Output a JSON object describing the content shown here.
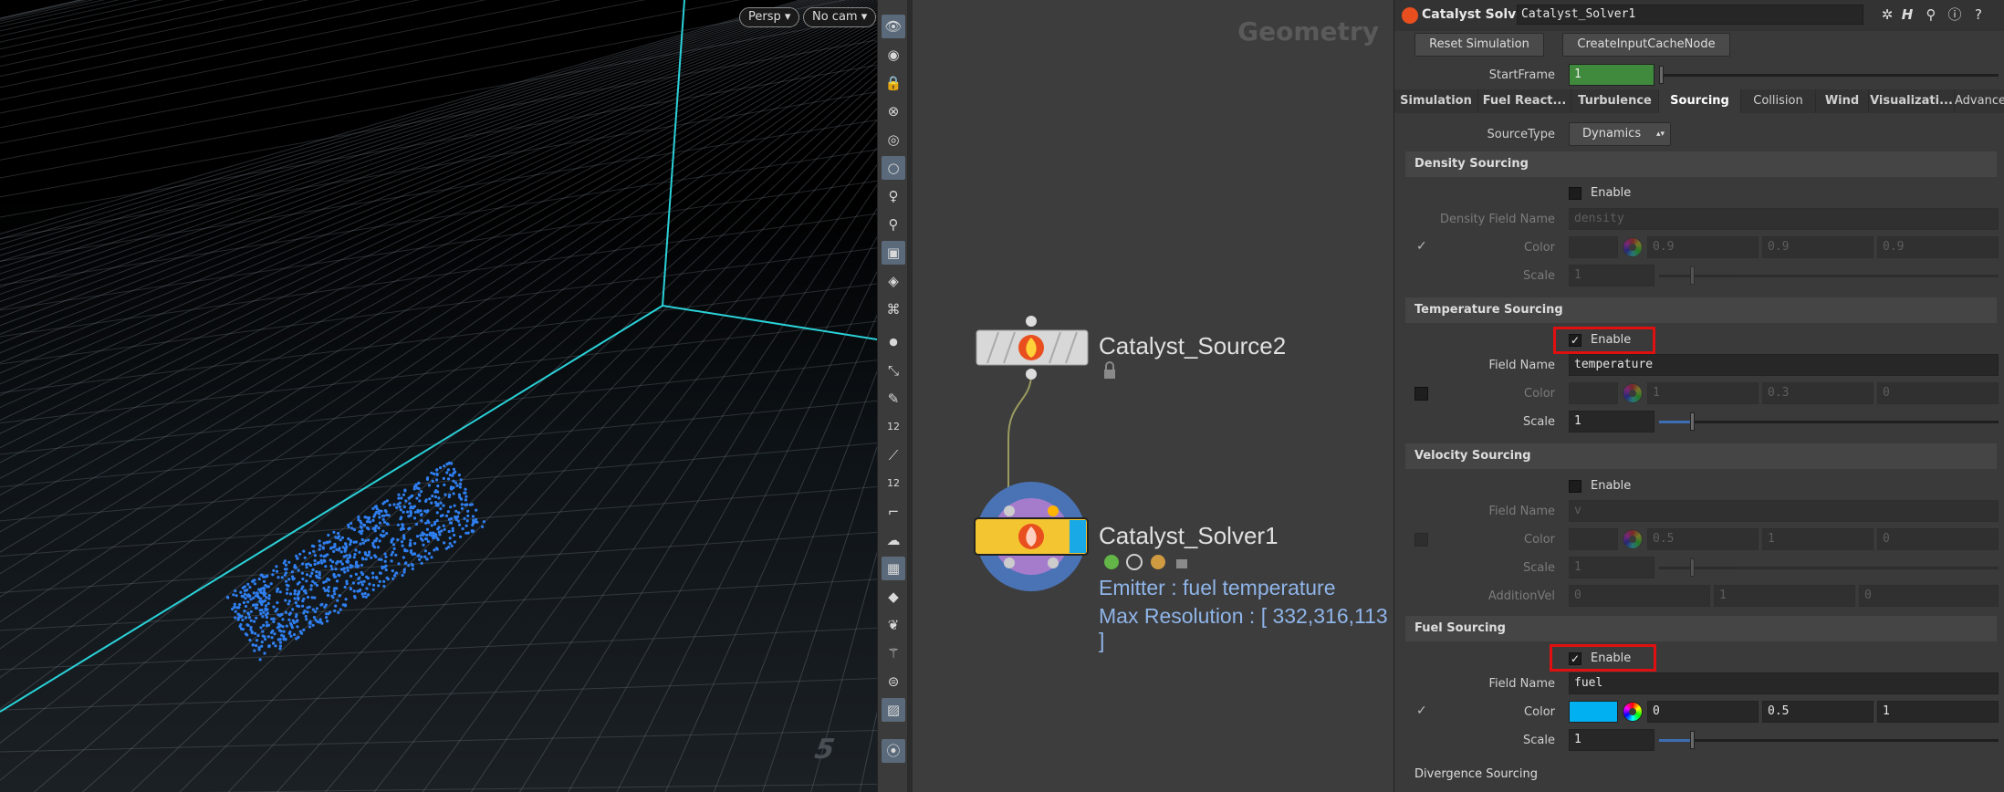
{
  "viewport": {
    "persp_label": "Persp",
    "cam_label": "No cam",
    "axis_number": "5"
  },
  "toolbar": {
    "tools": [
      "eye-icon",
      "select-icon",
      "lock-icon",
      "ghost-icon",
      "sphere-icon",
      "light-icon",
      "bulb-icon",
      "pin-icon",
      "camera-icon",
      "render-icon",
      "capture-icon",
      "dot-icon",
      "brush-icon",
      "pen-icon",
      "twelve-icon",
      "knife-icon",
      "twelve-2-icon",
      "curve-icon",
      "cloud-icon",
      "grid-icon",
      "cube-icon",
      "leaf-icon",
      "wand-icon",
      "disc-icon",
      "image-icon",
      "marker-icon"
    ],
    "numbers": {
      "twelve": "12",
      "twelve_b": "12"
    }
  },
  "network": {
    "context": "Geometry",
    "source_node": "Catalyst_Source2",
    "solver_node": "Catalyst_Solver1",
    "emitter_info": "Emitter : fuel temperature",
    "resolution_info": "Max Resolution : [ 332,316,113 ]"
  },
  "params": {
    "node_type": "Catalyst Solver",
    "node_name": "Catalyst_Solver1",
    "reset_button": "Reset Simulation",
    "cache_button": "CreateInputCacheNode",
    "start_frame_label": "StartFrame",
    "start_frame_value": "1",
    "tabs": [
      "Simulation",
      "Fuel React...",
      "Turbulence",
      "Sourcing",
      "Collision",
      "Wind",
      "Visualizati...",
      "Advance"
    ],
    "active_tab": "Sourcing",
    "source_type_label": "SourceType",
    "source_type_value": "Dynamics",
    "density": {
      "title": "Density Sourcing",
      "enable": "Enable",
      "field_label": "Density Field Name",
      "field_value": "density",
      "color_label": "Color",
      "color": [
        "0.9",
        "0.9",
        "0.9"
      ],
      "scale_label": "Scale",
      "scale": "1"
    },
    "temperature": {
      "title": "Temperature Sourcing",
      "enable": "Enable",
      "field_label": "Field Name",
      "field_value": "temperature",
      "color_label": "Color",
      "color": [
        "1",
        "0.3",
        "0"
      ],
      "scale_label": "Scale",
      "scale": "1"
    },
    "velocity": {
      "title": "Velocity Sourcing",
      "enable": "Enable",
      "field_label": "Field Name",
      "field_value": "v",
      "color_label": "Color",
      "color": [
        "0.5",
        "1",
        "0"
      ],
      "scale_label": "Scale",
      "scale": "1",
      "add_label": "AdditionVel",
      "add": [
        "0",
        "1",
        "0"
      ]
    },
    "fuel": {
      "title": "Fuel Sourcing",
      "enable": "Enable",
      "field_label": "Field Name",
      "field_value": "fuel",
      "color_label": "Color",
      "color": [
        "0",
        "0.5",
        "1"
      ],
      "swatch_color": "#00b0f0",
      "scale_label": "Scale",
      "scale": "1"
    },
    "divergence_title": "Divergence Sourcing",
    "check_mark": "✓"
  },
  "colors": {
    "viewport_line": "#2ad1d8",
    "particles": "#2f7ff0",
    "highlight": "#e01010",
    "enabled_green": "#3f8a3c"
  }
}
